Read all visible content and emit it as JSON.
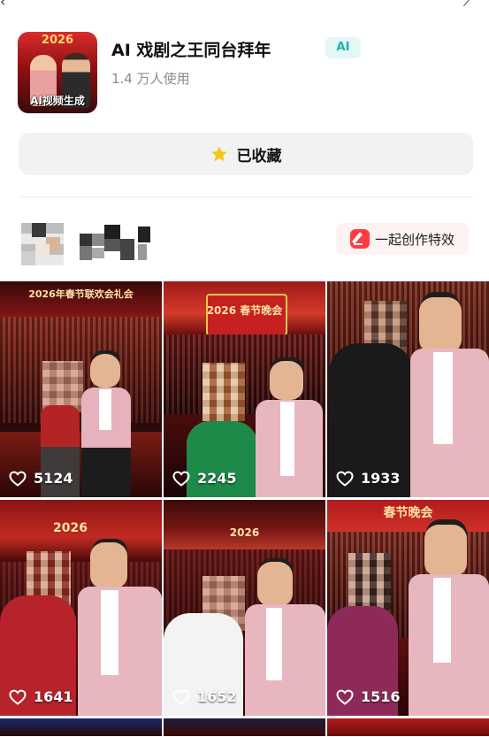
{
  "status_icons": {
    "left": "back-arrow-icon",
    "right": "share-icon"
  },
  "app": {
    "thumbnail_year": "2026",
    "thumbnail_caption": "AI视频生成",
    "title": "AI 戏剧之王同台拜年",
    "badge": "AI",
    "usage": "1.4 万人使用"
  },
  "favorite_button": {
    "label": "已收藏",
    "icon": "star-icon",
    "icon_color": "#f5c518"
  },
  "creator": {
    "cocreate_label": "一起创作特效",
    "cocreate_icon": "edit-icon",
    "accent": "#ff3b45"
  },
  "grid": {
    "items": [
      {
        "banner": "2026年春节联欢会礼会",
        "likes": "5124"
      },
      {
        "banner": "2026 春节晚会",
        "likes": "2245"
      },
      {
        "banner": "",
        "likes": "1933"
      },
      {
        "banner": "2026",
        "likes": "1641"
      },
      {
        "banner": "2026",
        "likes": "1652"
      },
      {
        "banner": "春节晚会",
        "likes": "1516"
      }
    ]
  }
}
